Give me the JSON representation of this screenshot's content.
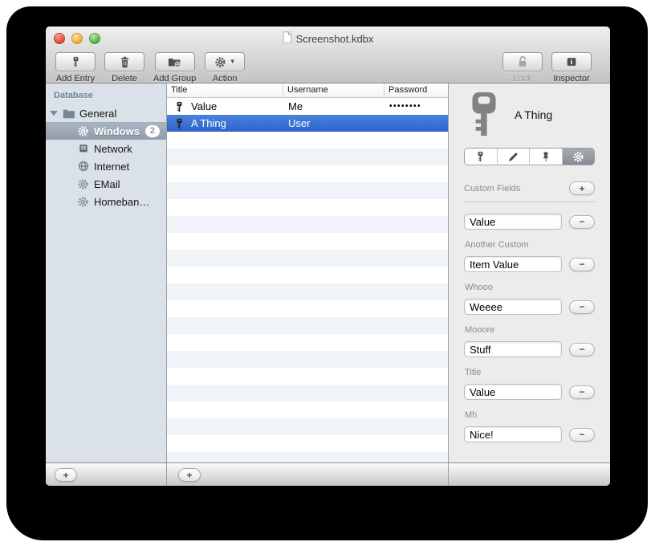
{
  "window": {
    "title": "Screenshot.kdbx"
  },
  "toolbar": {
    "left_buttons": [
      {
        "name": "add-entry",
        "label": "Add Entry",
        "icon": "key"
      },
      {
        "name": "delete",
        "label": "Delete",
        "icon": "trash"
      },
      {
        "name": "add-group",
        "label": "Add Group",
        "icon": "folder-plus"
      },
      {
        "name": "action",
        "label": "Action",
        "icon": "gear",
        "dropdown": true
      }
    ],
    "right_buttons": [
      {
        "name": "lock",
        "label": "Lock",
        "icon": "lock-open",
        "disabled": true
      },
      {
        "name": "inspector",
        "label": "Inspector",
        "icon": "info",
        "disabled": false
      }
    ]
  },
  "sidebar": {
    "header": "Database",
    "items": [
      {
        "label": "General",
        "icon": "folder",
        "disclosure": true,
        "level": 0,
        "selected": false
      },
      {
        "label": "Windows",
        "icon": "gear",
        "badge": "2",
        "level": 1,
        "selected": true
      },
      {
        "label": "Network",
        "icon": "network",
        "level": 1,
        "selected": false
      },
      {
        "label": "Internet",
        "icon": "globe",
        "level": 1,
        "selected": false
      },
      {
        "label": "EMail",
        "icon": "gear",
        "level": 1,
        "selected": false
      },
      {
        "label": "Homeban…",
        "icon": "gear",
        "level": 1,
        "selected": false
      }
    ]
  },
  "entry_table": {
    "columns": [
      "Title",
      "Username",
      "Password"
    ],
    "entries": [
      {
        "title": "Value",
        "username": "Me",
        "password": "••••••••",
        "selected": false
      },
      {
        "title": "A Thing",
        "username": "User",
        "password": "",
        "selected": true
      }
    ],
    "empty_rows": 20
  },
  "inspector": {
    "entry_title": "A Thing",
    "entry_icon": "key",
    "tabs": [
      {
        "icon": "key",
        "selected": false
      },
      {
        "icon": "pencil",
        "selected": false
      },
      {
        "icon": "pushpin",
        "selected": false
      },
      {
        "icon": "gear",
        "selected": true
      }
    ],
    "custom_fields_header": "Custom Fields",
    "add_button_label": "+",
    "remove_button_label": "−",
    "custom_fields": [
      {
        "label": "",
        "value": "Value"
      },
      {
        "label": "Another Custom",
        "value": "Item Value"
      },
      {
        "label": "Whooo",
        "value": "Weeee"
      },
      {
        "label": "Mooore",
        "value": "Stuff"
      },
      {
        "label": "Title",
        "value": "Value"
      },
      {
        "label": "Mh",
        "value": "Nice!"
      }
    ]
  },
  "bottom_bar": {
    "sidebar_add_label": "+",
    "table_add_label": "+"
  },
  "colors": {
    "selection_blue": "#3875d7",
    "sidebar_bg": "#dae1e9",
    "row_stripe": "#f0f4f9",
    "sidebar_selection": "#99a4b3"
  }
}
